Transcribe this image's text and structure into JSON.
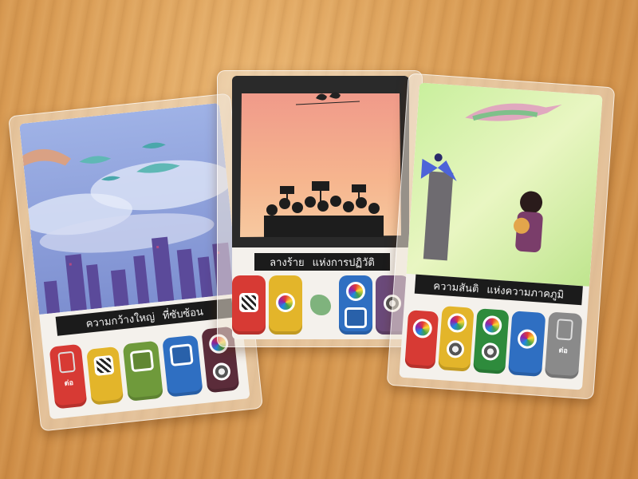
{
  "scene": {
    "description_hidden": "",
    "table_color": "#d89a52"
  },
  "cards": [
    {
      "title_left": "ความกว้างใหญ่",
      "title_right": "ที่ซับซ้อน",
      "slot_colors": [
        "#d73a34",
        "#e3b52a",
        "#6f9a3b",
        "#2f6fc2",
        "#5b2c3a"
      ],
      "slot_symbols": [
        "gear-lock-icon",
        "stripes-icon",
        "triangle-icon",
        "triangle-icon",
        "sun-icon"
      ],
      "slot_label": "ต่อ"
    },
    {
      "title_left": "ลางร้าย",
      "title_right": "แห่งการปฏิวัติ",
      "slot_colors": [
        "#d73a34",
        "#e3b52a",
        "#2f6fc2",
        "#6b4a7a"
      ],
      "slot_symbols": [
        "stripes-icon",
        "color-wheel-icon",
        "color-wheel-triangle-icon",
        "sun-icon"
      ],
      "center_symbol": "leaf-emblem-icon"
    },
    {
      "title_left": "ความสันติ",
      "title_right": "แห่งความภาคภูมิ",
      "slot_colors": [
        "#d73a34",
        "#e3b52a",
        "#2e8b3c",
        "#2f6fc2",
        "#8a8a8a"
      ],
      "slot_symbols": [
        "color-wheel-icon",
        "color-wheel-sun-icon",
        "color-wheel-sun-icon",
        "color-wheel-icon",
        "gear-lock-icon"
      ],
      "slot_label": "ต่อ"
    }
  ]
}
